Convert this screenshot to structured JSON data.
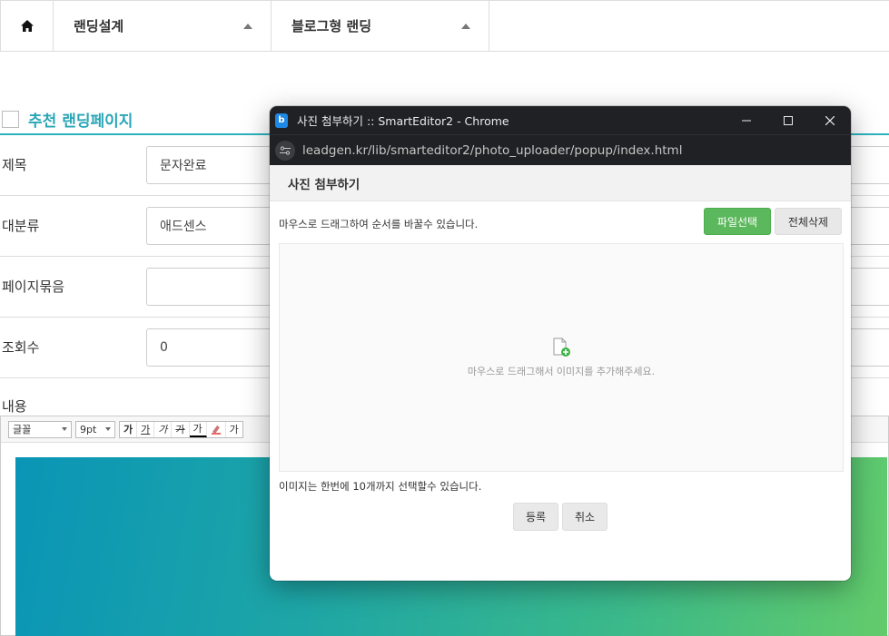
{
  "nav": {
    "home_icon": "home-icon",
    "items": [
      {
        "label": "랜딩설계"
      },
      {
        "label": "블로그형 랜딩"
      }
    ]
  },
  "section": {
    "title": "추천 랜딩페이지"
  },
  "form": {
    "rows": [
      {
        "label": "제목",
        "value": "문자완료"
      },
      {
        "label": "대분류",
        "value": "애드센스"
      },
      {
        "label": "페이지묶음",
        "value": ""
      },
      {
        "label": "조회수",
        "value": "0"
      }
    ],
    "content_label": "내용"
  },
  "editor": {
    "font_select": "글꼴",
    "size_select": "9pt",
    "buttons": [
      "가",
      "가",
      "가",
      "가",
      "가",
      "가"
    ]
  },
  "popup": {
    "window_title": "사진 첨부하기 :: SmartEditor2 - Chrome",
    "url": "leadgen.kr/lib/smarteditor2/photo_uploader/popup/index.html",
    "heading": "사진 첨부하기",
    "drag_hint": "마우스로 드래그하여 순서를 바꿀수 있습니다.",
    "file_select_label": "파일선택",
    "delete_all_label": "전체삭제",
    "dropzone_text": "마우스로 드래그해서 이미지를 추가해주세요.",
    "limit_text": "이미지는 한번에 10개까지 선택할수 있습니다.",
    "submit_label": "등록",
    "cancel_label": "취소",
    "accent_color": "#5cb85c"
  },
  "colors": {
    "section_accent": "#2bb3c0",
    "titlebar": "#202124"
  }
}
